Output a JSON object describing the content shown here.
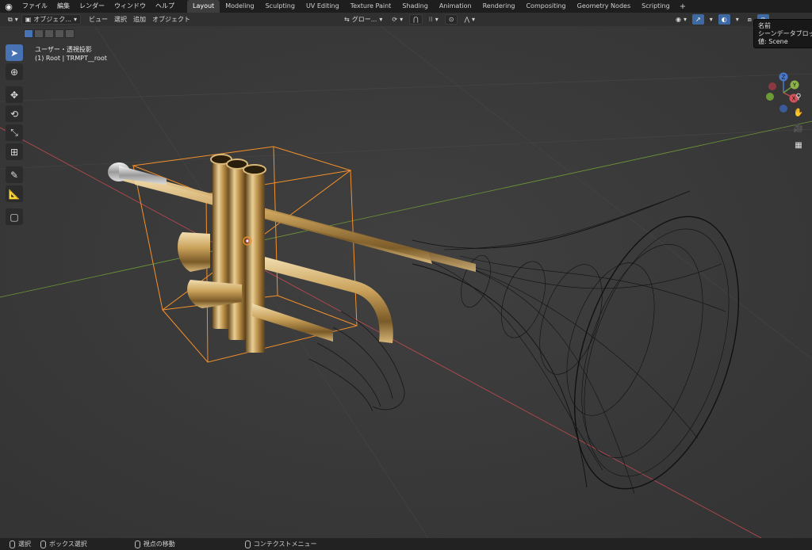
{
  "menu": {
    "file": "ファイル",
    "edit": "編集",
    "render": "レンダー",
    "window": "ウィンドウ",
    "help": "ヘルプ"
  },
  "workspaces": [
    {
      "label": "Layout",
      "active": true
    },
    {
      "label": "Modeling"
    },
    {
      "label": "Sculpting"
    },
    {
      "label": "UV Editing"
    },
    {
      "label": "Texture Paint"
    },
    {
      "label": "Shading"
    },
    {
      "label": "Animation"
    },
    {
      "label": "Rendering"
    },
    {
      "label": "Compositing"
    },
    {
      "label": "Geometry Nodes"
    },
    {
      "label": "Scripting"
    }
  ],
  "workspace_add": "+",
  "header": {
    "mode": "オブジェク...",
    "view": "ビュー",
    "select": "選択",
    "add": "追加",
    "object": "オブジェクト",
    "transform_orientation": "グロー..."
  },
  "viewport": {
    "view_name": "ユーザー・透視投影",
    "collection_info": "(1) Root | TRMPT__root"
  },
  "tooltip": {
    "title": "名前",
    "line1": "シーンデータブロック",
    "line2": "値: Scene"
  },
  "gizmo": {
    "z": "Z",
    "y": "Y",
    "x": "X"
  },
  "statusbar": {
    "select": "選択",
    "box_select": "ボックス選択",
    "move_view": "視点の移動",
    "context_menu": "コンテクストメニュー"
  },
  "colors": {
    "accent": "#4772b3",
    "selection_outline": "#f5902a",
    "axis_x": "#c14a52",
    "axis_y": "#6e9a36",
    "brass": "#c9a15a"
  }
}
